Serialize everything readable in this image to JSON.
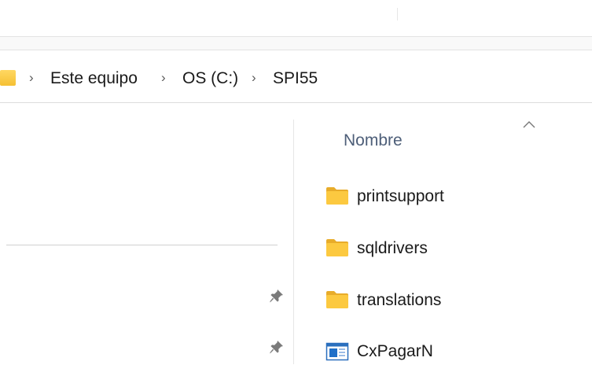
{
  "breadcrumb": {
    "items": [
      "Este equipo",
      "OS (C:)",
      "SPI55"
    ]
  },
  "file_list": {
    "column_header": "Nombre",
    "items": [
      {
        "name": "printsupport",
        "type": "folder"
      },
      {
        "name": "sqldrivers",
        "type": "folder"
      },
      {
        "name": "translations",
        "type": "folder"
      },
      {
        "name": "CxPagarN",
        "type": "application"
      }
    ]
  },
  "colors": {
    "folder": "#f5c033",
    "header_text": "#4d5e78",
    "app_icon": "#1f6fc8"
  }
}
